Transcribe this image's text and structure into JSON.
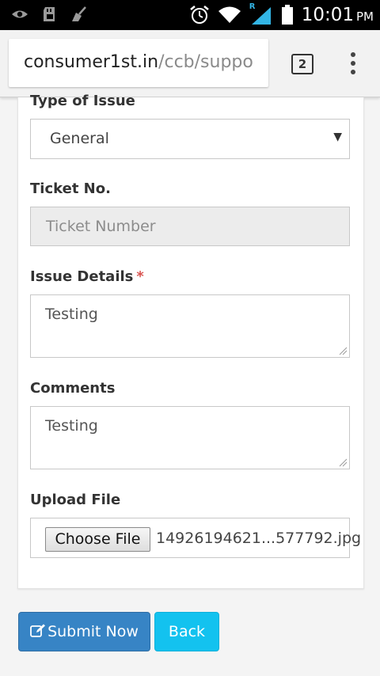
{
  "status_bar": {
    "time": "10:01",
    "ampm": "PM",
    "left_icons": [
      "eye-icon",
      "sd-card-icon",
      "broom-icon"
    ],
    "right_icons": [
      "alarm-icon",
      "wifi-icon",
      "signal-icon",
      "battery-icon"
    ],
    "signal_roaming_letter": "R"
  },
  "browser": {
    "url_domain": "consumer1st.in",
    "url_path": "/ccb/suppo",
    "tab_count": "2"
  },
  "form": {
    "type_label": "Type of Issue",
    "type_value": "General",
    "ticket_label": "Ticket No.",
    "ticket_placeholder": "Ticket Number",
    "issue_label": "Issue Details",
    "required_mark": "*",
    "issue_value": "Testing",
    "comments_label": "Comments",
    "comments_value": "Testing",
    "upload_label": "Upload File",
    "choose_file_label": "Choose File",
    "file_name": "14926194621...577792.jpg"
  },
  "actions": {
    "submit_label": "Submit Now",
    "back_label": "Back"
  },
  "colors": {
    "submit_bg": "#3784c5",
    "back_bg": "#13c2ef",
    "required": "#d9534f"
  }
}
